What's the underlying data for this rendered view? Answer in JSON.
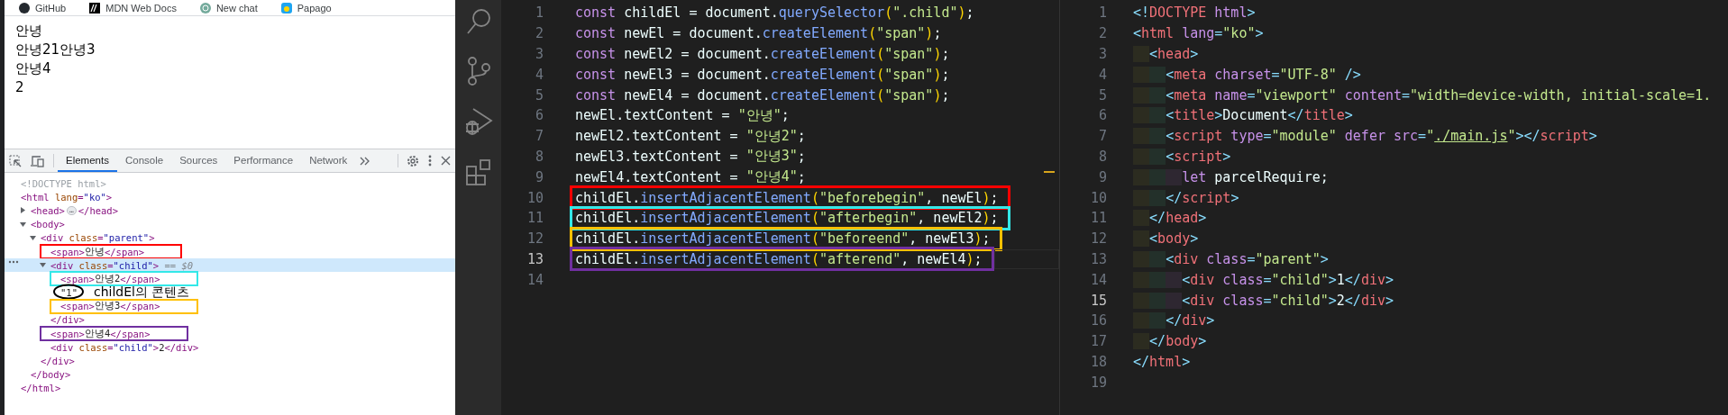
{
  "browser": {
    "bookmarks": [
      {
        "label": "GitHub",
        "kind": "github"
      },
      {
        "label": "MDN Web Docs",
        "kind": "mdn"
      },
      {
        "label": "New chat",
        "kind": "chat"
      },
      {
        "label": "Papago",
        "kind": "papago"
      }
    ],
    "page_lines": [
      "안녕",
      "안녕21안녕3",
      "안녕4",
      "2"
    ],
    "devtools": {
      "tabs": [
        {
          "label": "Elements",
          "selected": true
        },
        {
          "label": "Console",
          "selected": false
        },
        {
          "label": "Sources",
          "selected": false
        },
        {
          "label": "Performance",
          "selected": false
        },
        {
          "label": "Network",
          "selected": false
        }
      ],
      "tree": [
        {
          "tokens": [
            {
              "text": "<!DOCTYPE html>",
              "kind": "grey"
            }
          ],
          "selected": false
        },
        {
          "tokens": [
            {
              "text": "<html ",
              "kind": "tag"
            },
            {
              "text": "lang",
              "kind": "attr"
            },
            {
              "text": "=",
              "kind": "tag"
            },
            {
              "text": "\"ko\"",
              "kind": "val"
            },
            {
              "text": ">",
              "kind": "tag"
            }
          ],
          "selected": false,
          "closing": [
            {
              "text": "</html>",
              "kind": "tag"
            }
          ],
          "children": [
            {
              "tokens": [
                {
                  "text": "<head>",
                  "kind": "tag"
                },
                {
                  "text": "…",
                  "kind": "ellipsis"
                },
                {
                  "text": "</head>",
                  "kind": "tag"
                }
              ],
              "expanded": false,
              "selected": false
            },
            {
              "tokens": [
                {
                  "text": "<body>",
                  "kind": "tag"
                }
              ],
              "expanded": true,
              "selected": false,
              "closing": [
                {
                  "text": "</body>",
                  "kind": "tag"
                }
              ],
              "children": [
                {
                  "tokens": [
                    {
                      "text": "<div ",
                      "kind": "tag"
                    },
                    {
                      "text": "class",
                      "kind": "attr"
                    },
                    {
                      "text": "=",
                      "kind": "tag"
                    },
                    {
                      "text": "\"parent\"",
                      "kind": "val"
                    },
                    {
                      "text": ">",
                      "kind": "tag"
                    }
                  ],
                  "expanded": true,
                  "selected": false,
                  "closing": [
                    {
                      "text": "</div>",
                      "kind": "tag"
                    }
                  ],
                  "children": [
                    {
                      "tokens": [
                        {
                          "text": "<span>",
                          "kind": "tag"
                        },
                        {
                          "text": "안녕",
                          "kind": "text"
                        },
                        {
                          "text": "</span>",
                          "kind": "tag"
                        }
                      ],
                      "selected": false,
                      "color": "#ff0000"
                    },
                    {
                      "tokens": [
                        {
                          "text": "<div ",
                          "kind": "tag"
                        },
                        {
                          "text": "class",
                          "kind": "attr"
                        },
                        {
                          "text": "=",
                          "kind": "tag"
                        },
                        {
                          "text": "\"child\"",
                          "kind": "val"
                        },
                        {
                          "text": ">",
                          "kind": "tag"
                        },
                        {
                          "text": " == $0",
                          "kind": "ref"
                        }
                      ],
                      "expanded": true,
                      "selected": true,
                      "closing": [
                        {
                          "text": "</div>",
                          "kind": "tag"
                        }
                      ],
                      "children": [
                        {
                          "tokens": [
                            {
                              "text": "<span>",
                              "kind": "tag"
                            },
                            {
                              "text": "안녕2",
                              "kind": "text"
                            },
                            {
                              "text": "</span>",
                              "kind": "tag"
                            }
                          ],
                          "selected": false,
                          "color": "#33e8e8"
                        },
                        {
                          "tokens": [
                            {
                              "text": "\"1\"",
                              "kind": "text"
                            }
                          ],
                          "selected": false,
                          "note": "childEl의 콘텐츠"
                        },
                        {
                          "tokens": [
                            {
                              "text": "<span>",
                              "kind": "tag"
                            },
                            {
                              "text": "안녕3",
                              "kind": "text"
                            },
                            {
                              "text": "</span>",
                              "kind": "tag"
                            }
                          ],
                          "selected": false,
                          "color": "#ffc000"
                        }
                      ]
                    },
                    {
                      "tokens": [
                        {
                          "text": "<span>",
                          "kind": "tag"
                        },
                        {
                          "text": "안녕4",
                          "kind": "text"
                        },
                        {
                          "text": "</span>",
                          "kind": "tag"
                        }
                      ],
                      "selected": false,
                      "color": "#7030a0"
                    },
                    {
                      "tokens": [
                        {
                          "text": "<div ",
                          "kind": "tag"
                        },
                        {
                          "text": "class",
                          "kind": "attr"
                        },
                        {
                          "text": "=",
                          "kind": "tag"
                        },
                        {
                          "text": "\"child\"",
                          "kind": "val"
                        },
                        {
                          "text": ">",
                          "kind": "tag"
                        },
                        {
                          "text": "2",
                          "kind": "text"
                        },
                        {
                          "text": "</div>",
                          "kind": "tag"
                        }
                      ],
                      "selected": false
                    }
                  ]
                }
              ]
            }
          ]
        }
      ]
    }
  },
  "activity_bar": [
    {
      "kind": "search"
    },
    {
      "kind": "source-control"
    },
    {
      "kind": "run-debug"
    },
    {
      "kind": "extensions"
    }
  ],
  "editors": [
    {
      "lines": [
        {
          "number": "1",
          "current": false,
          "tokens": [
            {
              "text": "const",
              "kind": "kw"
            },
            {
              "text": " childEl = document.",
              "kind": "id"
            },
            {
              "text": "querySelector",
              "kind": "fn"
            },
            {
              "text": "(",
              "kind": "paren"
            },
            {
              "text": "\".child\"",
              "kind": "str"
            },
            {
              "text": ")",
              "kind": "paren"
            },
            {
              "text": ";",
              "kind": "id"
            }
          ]
        },
        {
          "number": "2",
          "current": false,
          "tokens": [
            {
              "text": "const",
              "kind": "kw"
            },
            {
              "text": " newEl = document.",
              "kind": "id"
            },
            {
              "text": "createElement",
              "kind": "fn"
            },
            {
              "text": "(",
              "kind": "paren"
            },
            {
              "text": "\"span\"",
              "kind": "str"
            },
            {
              "text": ")",
              "kind": "paren"
            },
            {
              "text": ";",
              "kind": "id"
            }
          ]
        },
        {
          "number": "3",
          "current": false,
          "tokens": [
            {
              "text": "const",
              "kind": "kw"
            },
            {
              "text": " newEl2 = document.",
              "kind": "id"
            },
            {
              "text": "createElement",
              "kind": "fn"
            },
            {
              "text": "(",
              "kind": "paren"
            },
            {
              "text": "\"span\"",
              "kind": "str"
            },
            {
              "text": ")",
              "kind": "paren"
            },
            {
              "text": ";",
              "kind": "id"
            }
          ]
        },
        {
          "number": "4",
          "current": false,
          "tokens": [
            {
              "text": "const",
              "kind": "kw"
            },
            {
              "text": " newEl3 = document.",
              "kind": "id"
            },
            {
              "text": "createElement",
              "kind": "fn"
            },
            {
              "text": "(",
              "kind": "paren"
            },
            {
              "text": "\"span\"",
              "kind": "str"
            },
            {
              "text": ")",
              "kind": "paren"
            },
            {
              "text": ";",
              "kind": "id"
            }
          ]
        },
        {
          "number": "5",
          "current": false,
          "tokens": [
            {
              "text": "const",
              "kind": "kw"
            },
            {
              "text": " newEl4 = document.",
              "kind": "id"
            },
            {
              "text": "createElement",
              "kind": "fn"
            },
            {
              "text": "(",
              "kind": "paren"
            },
            {
              "text": "\"span\"",
              "kind": "str"
            },
            {
              "text": ")",
              "kind": "paren"
            },
            {
              "text": ";",
              "kind": "id"
            }
          ]
        },
        {
          "number": "6",
          "current": false,
          "tokens": [
            {
              "text": "newEl.textContent = ",
              "kind": "id"
            },
            {
              "text": "\"안녕\"",
              "kind": "str"
            },
            {
              "text": ";",
              "kind": "id"
            }
          ]
        },
        {
          "number": "7",
          "current": false,
          "tokens": [
            {
              "text": "newEl2.textContent = ",
              "kind": "id"
            },
            {
              "text": "\"안녕2\"",
              "kind": "str"
            },
            {
              "text": ";",
              "kind": "id"
            }
          ]
        },
        {
          "number": "8",
          "current": false,
          "tokens": [
            {
              "text": "newEl3.textContent = ",
              "kind": "id"
            },
            {
              "text": "\"안녕3\"",
              "kind": "str"
            },
            {
              "text": ";",
              "kind": "id"
            }
          ]
        },
        {
          "number": "9",
          "current": false,
          "tokens": [
            {
              "text": "newEl4.textContent = ",
              "kind": "id"
            },
            {
              "text": "\"안녕4\"",
              "kind": "str"
            },
            {
              "text": ";",
              "kind": "id"
            }
          ]
        },
        {
          "number": "10",
          "current": false,
          "color": "#ff0000",
          "tokens": [
            {
              "text": "childEl.",
              "kind": "id"
            },
            {
              "text": "insertAdjacentElement",
              "kind": "fn"
            },
            {
              "text": "(",
              "kind": "paren"
            },
            {
              "text": "\"beforebegin\"",
              "kind": "str"
            },
            {
              "text": ", newEl",
              "kind": "id"
            },
            {
              "text": ")",
              "kind": "paren"
            },
            {
              "text": ";",
              "kind": "id"
            }
          ]
        },
        {
          "number": "11",
          "current": false,
          "color": "#33e8e8",
          "tokens": [
            {
              "text": "childEl.",
              "kind": "id"
            },
            {
              "text": "insertAdjacentElement",
              "kind": "fn"
            },
            {
              "text": "(",
              "kind": "paren"
            },
            {
              "text": "\"afterbegin\"",
              "kind": "str"
            },
            {
              "text": ", newEl2",
              "kind": "id"
            },
            {
              "text": ")",
              "kind": "paren"
            },
            {
              "text": ";",
              "kind": "id"
            }
          ]
        },
        {
          "number": "12",
          "current": false,
          "color": "#ffc000",
          "tokens": [
            {
              "text": "childEl.",
              "kind": "id"
            },
            {
              "text": "insertAdjacentElement",
              "kind": "fn"
            },
            {
              "text": "(",
              "kind": "paren"
            },
            {
              "text": "\"beforeend\"",
              "kind": "str"
            },
            {
              "text": ", newEl3",
              "kind": "id"
            },
            {
              "text": ")",
              "kind": "paren"
            },
            {
              "text": ";",
              "kind": "id"
            }
          ]
        },
        {
          "number": "13",
          "current": true,
          "color": "#7030a0",
          "tokens": [
            {
              "text": "childEl.",
              "kind": "id"
            },
            {
              "text": "insertAdjacentElement",
              "kind": "fn"
            },
            {
              "text": "(",
              "kind": "paren"
            },
            {
              "text": "\"afterend\"",
              "kind": "str"
            },
            {
              "text": ", newEl4",
              "kind": "id"
            },
            {
              "text": ")",
              "kind": "paren"
            },
            {
              "text": ";",
              "kind": "id"
            }
          ]
        },
        {
          "number": "14",
          "current": false
        }
      ]
    },
    {
      "lines": [
        {
          "number": "1",
          "current": false,
          "tokens": [
            {
              "text": "<!",
              "kind": "br"
            },
            {
              "text": "DOCTYPE",
              "kind": "tag"
            },
            {
              "text": " html",
              "kind": "attr"
            },
            {
              "text": ">",
              "kind": "br"
            }
          ]
        },
        {
          "number": "2",
          "current": false,
          "tokens": [
            {
              "text": "<",
              "kind": "br"
            },
            {
              "text": "html",
              "kind": "tag"
            },
            {
              "text": " lang",
              "kind": "attr"
            },
            {
              "text": "=",
              "kind": "br"
            },
            {
              "text": "\"ko\"",
              "kind": "str"
            },
            {
              "text": ">",
              "kind": "br"
            }
          ]
        },
        {
          "number": "3",
          "current": false,
          "tokens": [
            {
              "text": "  <",
              "kind": "br"
            },
            {
              "text": "head",
              "kind": "tag"
            },
            {
              "text": ">",
              "kind": "br"
            }
          ]
        },
        {
          "number": "4",
          "current": false,
          "tokens": [
            {
              "text": "    <",
              "kind": "br"
            },
            {
              "text": "meta",
              "kind": "tag"
            },
            {
              "text": " charset",
              "kind": "attr"
            },
            {
              "text": "=",
              "kind": "br"
            },
            {
              "text": "\"UTF-8\"",
              "kind": "str"
            },
            {
              "text": " />",
              "kind": "br"
            }
          ]
        },
        {
          "number": "5",
          "current": false,
          "tokens": [
            {
              "text": "    <",
              "kind": "br"
            },
            {
              "text": "meta",
              "kind": "tag"
            },
            {
              "text": " name",
              "kind": "attr"
            },
            {
              "text": "=",
              "kind": "br"
            },
            {
              "text": "\"viewport\"",
              "kind": "str"
            },
            {
              "text": " content",
              "kind": "attr"
            },
            {
              "text": "=",
              "kind": "br"
            },
            {
              "text": "\"width=device-width, initial-scale=1.",
              "kind": "str"
            }
          ]
        },
        {
          "number": "6",
          "current": false,
          "tokens": [
            {
              "text": "    <",
              "kind": "br"
            },
            {
              "text": "title",
              "kind": "tag"
            },
            {
              "text": ">",
              "kind": "br"
            },
            {
              "text": "Document",
              "kind": "text"
            },
            {
              "text": "</",
              "kind": "br"
            },
            {
              "text": "title",
              "kind": "tag"
            },
            {
              "text": ">",
              "kind": "br"
            }
          ]
        },
        {
          "number": "7",
          "current": false,
          "tokens": [
            {
              "text": "    <",
              "kind": "br"
            },
            {
              "text": "script",
              "kind": "tag"
            },
            {
              "text": " type",
              "kind": "attr"
            },
            {
              "text": "=",
              "kind": "br"
            },
            {
              "text": "\"module\"",
              "kind": "str"
            },
            {
              "text": " defer src",
              "kind": "attr"
            },
            {
              "text": "=",
              "kind": "br"
            },
            {
              "text": "\"",
              "kind": "str"
            },
            {
              "text": "./main.js",
              "kind": "link"
            },
            {
              "text": "\"",
              "kind": "str"
            },
            {
              "text": "></",
              "kind": "br"
            },
            {
              "text": "script",
              "kind": "tag"
            },
            {
              "text": ">",
              "kind": "br"
            }
          ]
        },
        {
          "number": "8",
          "current": false,
          "tokens": [
            {
              "text": "    <",
              "kind": "br"
            },
            {
              "text": "script",
              "kind": "tag"
            },
            {
              "text": ">",
              "kind": "br"
            }
          ]
        },
        {
          "number": "9",
          "current": false,
          "tokens": [
            {
              "text": "      let",
              "kind": "kw"
            },
            {
              "text": " parcelRequire;",
              "kind": "text"
            }
          ]
        },
        {
          "number": "10",
          "current": false,
          "tokens": [
            {
              "text": "    </",
              "kind": "br"
            },
            {
              "text": "script",
              "kind": "tag"
            },
            {
              "text": ">",
              "kind": "br"
            }
          ]
        },
        {
          "number": "11",
          "current": false,
          "tokens": [
            {
              "text": "  </",
              "kind": "br"
            },
            {
              "text": "head",
              "kind": "tag"
            },
            {
              "text": ">",
              "kind": "br"
            }
          ]
        },
        {
          "number": "12",
          "current": false,
          "tokens": [
            {
              "text": "  <",
              "kind": "br"
            },
            {
              "text": "body",
              "kind": "tag"
            },
            {
              "text": ">",
              "kind": "br"
            }
          ]
        },
        {
          "number": "13",
          "current": false,
          "tokens": [
            {
              "text": "    <",
              "kind": "br"
            },
            {
              "text": "div",
              "kind": "tag"
            },
            {
              "text": " class",
              "kind": "attr"
            },
            {
              "text": "=",
              "kind": "br"
            },
            {
              "text": "\"parent\"",
              "kind": "str"
            },
            {
              "text": ">",
              "kind": "br"
            }
          ]
        },
        {
          "number": "14",
          "current": false,
          "tokens": [
            {
              "text": "      <",
              "kind": "br"
            },
            {
              "text": "div",
              "kind": "tag"
            },
            {
              "text": " class",
              "kind": "attr"
            },
            {
              "text": "=",
              "kind": "br"
            },
            {
              "text": "\"child\"",
              "kind": "str"
            },
            {
              "text": ">",
              "kind": "br"
            },
            {
              "text": "1",
              "kind": "text"
            },
            {
              "text": "</",
              "kind": "br"
            },
            {
              "text": "div",
              "kind": "tag"
            },
            {
              "text": ">",
              "kind": "br"
            }
          ]
        },
        {
          "number": "15",
          "current": true,
          "tokens": [
            {
              "text": "      <",
              "kind": "br"
            },
            {
              "text": "div",
              "kind": "tag"
            },
            {
              "text": " class",
              "kind": "attr"
            },
            {
              "text": "=",
              "kind": "br"
            },
            {
              "text": "\"child\"",
              "kind": "str"
            },
            {
              "text": ">",
              "kind": "br"
            },
            {
              "text": "2",
              "kind": "text"
            },
            {
              "text": "</",
              "kind": "br"
            },
            {
              "text": "div",
              "kind": "tag"
            },
            {
              "text": ">",
              "kind": "br"
            }
          ]
        },
        {
          "number": "16",
          "current": false,
          "tokens": [
            {
              "text": "    </",
              "kind": "br"
            },
            {
              "text": "div",
              "kind": "tag"
            },
            {
              "text": ">",
              "kind": "br"
            }
          ]
        },
        {
          "number": "17",
          "current": false,
          "tokens": [
            {
              "text": "  </",
              "kind": "br"
            },
            {
              "text": "body",
              "kind": "tag"
            },
            {
              "text": ">",
              "kind": "br"
            }
          ]
        },
        {
          "number": "18",
          "current": false,
          "tokens": [
            {
              "text": "</",
              "kind": "br"
            },
            {
              "text": "html",
              "kind": "tag"
            },
            {
              "text": ">",
              "kind": "br"
            }
          ]
        },
        {
          "number": "19",
          "current": false
        }
      ]
    }
  ]
}
